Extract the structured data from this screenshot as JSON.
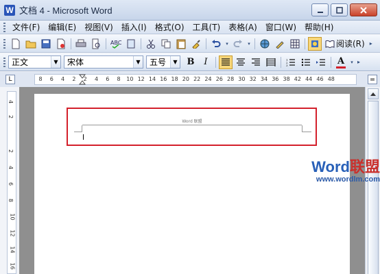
{
  "window": {
    "title": "文档 4 - Microsoft Word",
    "app_icon_letter": "W"
  },
  "menu": {
    "items": [
      "文件(F)",
      "编辑(E)",
      "视图(V)",
      "插入(I)",
      "格式(O)",
      "工具(T)",
      "表格(A)",
      "窗口(W)",
      "帮助(H)"
    ]
  },
  "toolbar": {
    "reading_label": "阅读(R)"
  },
  "format": {
    "style_value": "正文",
    "font_value": "宋体",
    "size_value": "五号",
    "bold_label": "B",
    "italic_label": "I",
    "font_color_label": "A"
  },
  "ruler": {
    "corner_label": "L",
    "numbers": [
      "8",
      "6",
      "4",
      "2",
      "2",
      "4",
      "6",
      "8",
      "10",
      "12",
      "14",
      "16",
      "18",
      "20",
      "22",
      "24",
      "26",
      "28",
      "30",
      "32",
      "34",
      "36",
      "38",
      "42",
      "44",
      "46",
      "48"
    ],
    "vertical_numbers": [
      "4",
      "2",
      "2",
      "4",
      "6",
      "8",
      "10",
      "12",
      "14",
      "16"
    ]
  },
  "document": {
    "header_text": "Word 联盟"
  },
  "watermark": {
    "logo_main": "Word",
    "logo_accent": "联盟",
    "url": "www.wordlm.com"
  },
  "colors": {
    "highlight_border": "#d31f2a",
    "accent_blue": "#2860b8"
  }
}
